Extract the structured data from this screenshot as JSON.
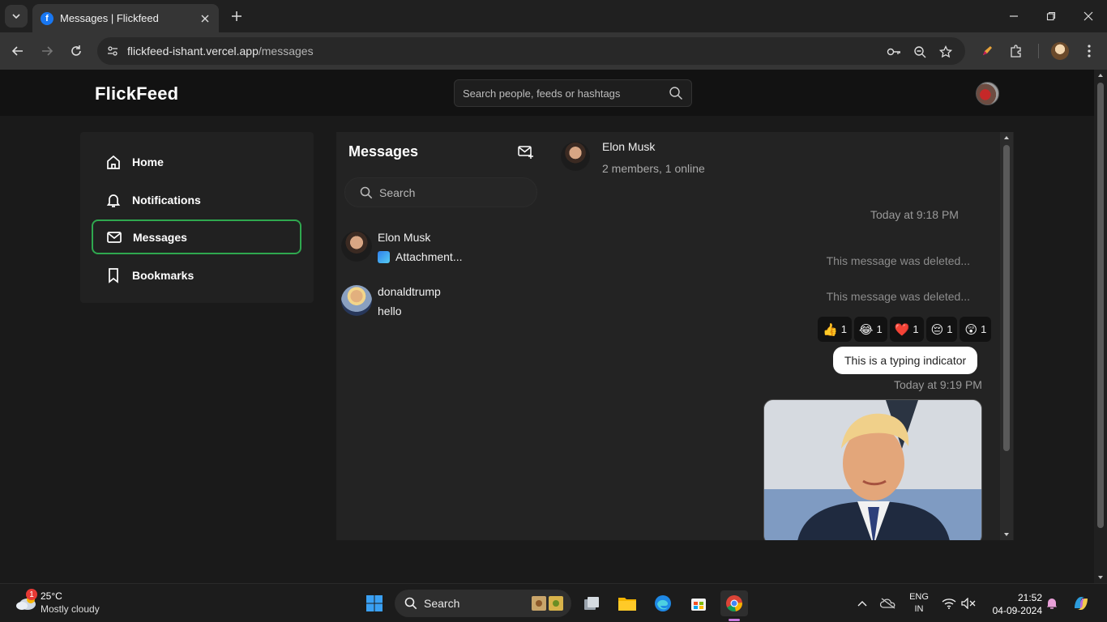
{
  "browser": {
    "tab_title": "Messages | Flickfeed",
    "favicon_letter": "f",
    "url_host": "flickfeed-ishant.vercel.app",
    "url_path": "/messages"
  },
  "app": {
    "logo": "FlickFeed",
    "search_placeholder": "Search people, feeds or hashtags"
  },
  "sidebar": {
    "items": [
      {
        "label": "Home",
        "icon": "home-icon"
      },
      {
        "label": "Notifications",
        "icon": "bell-icon"
      },
      {
        "label": "Messages",
        "icon": "mail-icon",
        "active": true
      },
      {
        "label": "Bookmarks",
        "icon": "bookmark-icon"
      }
    ]
  },
  "messages": {
    "title": "Messages",
    "search_placeholder": "Search",
    "conversations": [
      {
        "name": "Elon Musk",
        "preview": "Attachment..."
      },
      {
        "name": "donaldtrump",
        "preview": "hello"
      }
    ]
  },
  "chat": {
    "name": "Elon Musk",
    "subtitle": "2 members, 1 online",
    "timestamp_1": "Today at 9:18 PM",
    "deleted_1": "This message was deleted...",
    "deleted_2": "This message was deleted...",
    "reactions": [
      {
        "emoji": "👍",
        "count": "1"
      },
      {
        "emoji": "😂",
        "count": "1"
      },
      {
        "emoji": "❤️",
        "count": "1"
      },
      {
        "emoji": "😔",
        "count": "1"
      },
      {
        "emoji": "😲",
        "count": "1"
      }
    ],
    "typing_text": "This is a typing indicator",
    "timestamp_2": "Today at 9:19 PM"
  },
  "taskbar": {
    "weather_temp": "25°C",
    "weather_desc": "Mostly cloudy",
    "weather_badge": "1",
    "search_label": "Search",
    "lang_1": "ENG",
    "lang_2": "IN",
    "time": "21:52",
    "date": "04-09-2024"
  },
  "colors": {
    "accent_active": "#2fa84f",
    "background": "#1a1a1a",
    "panel": "#232323"
  }
}
